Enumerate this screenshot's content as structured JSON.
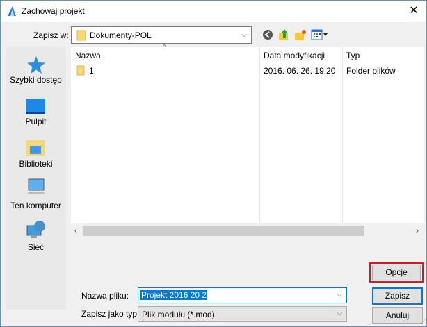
{
  "window": {
    "title": "Zachowaj projekt",
    "close_icon": "close-icon"
  },
  "toolbar": {
    "save_in_label": "Zapisz w:",
    "location": "Dokumenty-POL"
  },
  "sidebar": {
    "items": [
      {
        "label": "Szybki dostęp",
        "icon": "star-icon"
      },
      {
        "label": "Pulpit",
        "icon": "desktop-icon"
      },
      {
        "label": "Biblioteki",
        "icon": "libraries-icon"
      },
      {
        "label": "Ten komputer",
        "icon": "computer-icon"
      },
      {
        "label": "Sieć",
        "icon": "network-icon"
      }
    ]
  },
  "columns": [
    "Nazwa",
    "Data modyfikacji",
    "Typ"
  ],
  "rows": [
    {
      "name": "1",
      "date": "2016. 06. 26. 19:20",
      "type": "Folder plików"
    }
  ],
  "form": {
    "filename_label": "Nazwa pliku:",
    "filename": "Projekt 2016 20 2",
    "type_label": "Zapisz jako typ:",
    "type": "Plik modułu (*.mod)"
  },
  "buttons": {
    "options": "Opcje",
    "save": "Zapisz",
    "cancel": "Anuluj"
  },
  "colors": {
    "highlight": "#e81123",
    "accent": "#0078d7"
  }
}
